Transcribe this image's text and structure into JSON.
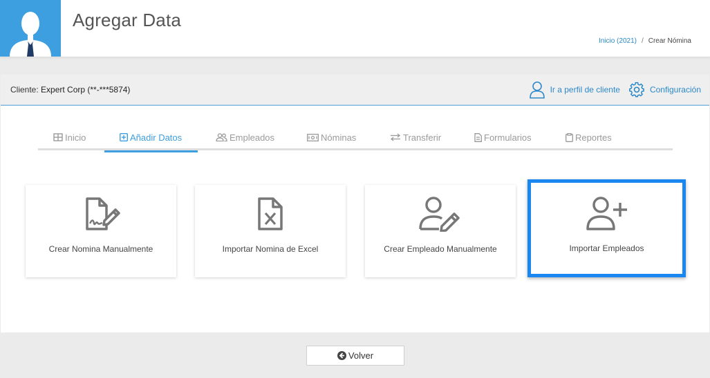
{
  "header": {
    "title": "Agregar Data",
    "breadcrumb": [
      {
        "label": "Inicio (2021)"
      },
      {
        "label": "Crear Nómina"
      }
    ],
    "breadcrumb_separator": "/"
  },
  "client_bar": {
    "label": "Cliente:",
    "value": "Expert Corp (**-***5874)",
    "actions": {
      "profile": {
        "label": "Ir a perfil de cliente",
        "icon": "user-outline-icon"
      },
      "config": {
        "label": "Configuración",
        "icon": "gear-icon"
      }
    }
  },
  "tabs": [
    {
      "label": "Inicio",
      "icon": "grid-icon",
      "active": false
    },
    {
      "label": "Añadir Datos",
      "icon": "plus-square-icon",
      "active": true
    },
    {
      "label": "Empleados",
      "icon": "users-icon",
      "active": false
    },
    {
      "label": "Nóminas",
      "icon": "money-bill-icon",
      "active": false
    },
    {
      "label": "Transferir",
      "icon": "exchange-arrows-icon",
      "active": false
    },
    {
      "label": "Formularios",
      "icon": "document-icon",
      "active": false
    },
    {
      "label": "Reportes",
      "icon": "clipboard-icon",
      "active": false
    }
  ],
  "tiles": [
    {
      "label": "Crear Nomina Manualmente",
      "icon": "file-signature-icon"
    },
    {
      "label": "Importar Nomina de Excel",
      "icon": "file-excel-icon"
    },
    {
      "label": "Crear Empleado Manualmente",
      "icon": "user-edit-icon"
    },
    {
      "label": "Importar Empleados",
      "icon": "user-plus-icon",
      "highlighted": true
    }
  ],
  "footer": {
    "back_label": "Volver",
    "back_icon": "arrow-circle-left-icon"
  },
  "colors": {
    "accent": "#3d9ee0",
    "link": "#2a88c9",
    "highlight_border": "#1a86f0",
    "icon_gray": "#777777"
  }
}
